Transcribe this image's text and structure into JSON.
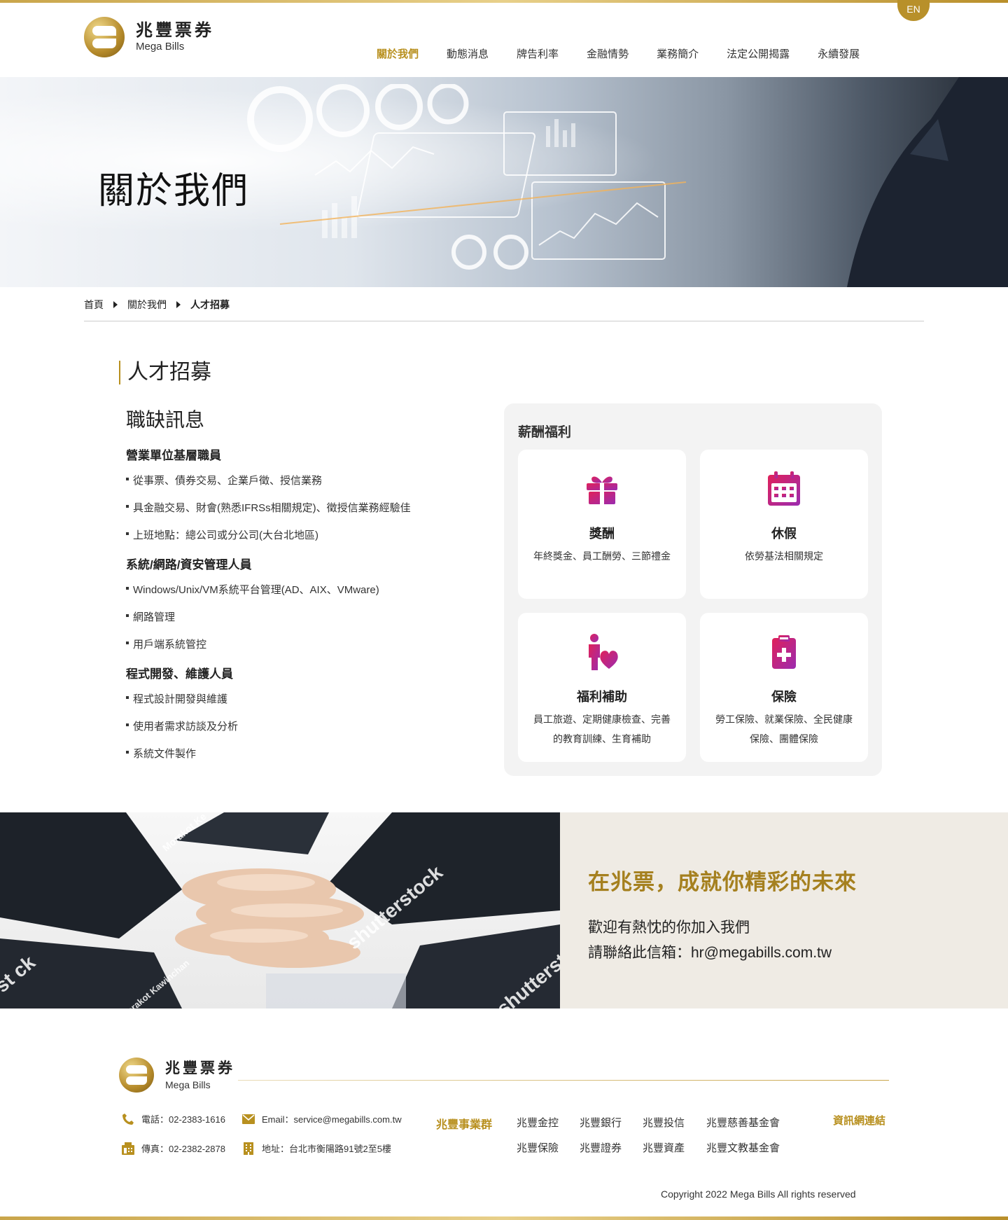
{
  "header": {
    "logo_zh": "兆豐票券",
    "logo_en": "Mega Bills",
    "lang_button": "EN",
    "nav": [
      {
        "label": "關於我們",
        "active": true
      },
      {
        "label": "動態消息",
        "active": false
      },
      {
        "label": "牌告利率",
        "active": false
      },
      {
        "label": "金融情勢",
        "active": false
      },
      {
        "label": "業務簡介",
        "active": false
      },
      {
        "label": "法定公開揭露",
        "active": false
      },
      {
        "label": "永續發展",
        "active": false
      }
    ]
  },
  "hero": {
    "title": "關於我們"
  },
  "breadcrumb": [
    "首頁",
    "關於我們",
    "人才招募"
  ],
  "page": {
    "section_title": "人才招募",
    "subtitle": "職缺訊息"
  },
  "jobs": [
    {
      "title": "營業單位基層職員",
      "items": [
        "從事票、債券交易、企業戶徵、授信業務",
        "具金融交易、財會(熟悉IFRSs相關規定)、徵授信業務經驗佳",
        "上班地點：總公司或分公司(大台北地區)"
      ]
    },
    {
      "title": "系統/網路/資安管理人員",
      "items": [
        "Windows/Unix/VM系統平台管理(AD、AIX、VMware)",
        "網路管理",
        "用戶端系統管控"
      ]
    },
    {
      "title": "程式開發、維護人員",
      "items": [
        "程式設計開發與維護",
        "使用者需求訪談及分析",
        "系統文件製作"
      ]
    }
  ],
  "benefits": {
    "title": "薪酬福利",
    "cards": [
      {
        "icon": "gift-icon",
        "title": "獎酬",
        "desc": "年終獎金、員工酬勞、三節禮金"
      },
      {
        "icon": "calendar-icon",
        "title": "休假",
        "desc": "依勞基法相關規定"
      },
      {
        "icon": "person-heart-icon",
        "title": "福利補助",
        "desc": "員工旅遊、定期健康檢查、完善的教育訓練、生育補助"
      },
      {
        "icon": "medical-clipboard-icon",
        "title": "保險",
        "desc": "勞工保險、就業保險、全民健康保險、團體保險"
      }
    ],
    "icon_colors": [
      "#e0215a",
      "#9b2bb0"
    ]
  },
  "recruit": {
    "title": "在兆票，成就你精彩的未來",
    "line1": "歡迎有熱忱的你加入我們",
    "line2": "請聯絡此信箱：hr@megabills.com.tw",
    "watermarks": [
      "shutterstock",
      "shutterst",
      "st ck",
      "Morakot Ke",
      "Morakot Kawinchan"
    ]
  },
  "footer": {
    "logo_zh": "兆豐票券",
    "logo_en": "Mega Bills",
    "phone": "電話：02-2383-1616",
    "email": "Email：service@megabills.com.tw",
    "fax": "傳真：02-2382-2878",
    "address": "地址：台北市衡陽路91號2至5樓",
    "group_label": "兆豐事業群",
    "group_links": [
      "兆豐金控",
      "兆豐銀行",
      "兆豐投信",
      "兆豐慈善基金會",
      "兆豐保險",
      "兆豐證券",
      "兆豐資產",
      "兆豐文教基金會"
    ],
    "info_link": "資訊網連結",
    "copyright": "Copyright 2022 Mega Bills All rights reserved"
  },
  "colors": {
    "accent_gold": "#b8901f",
    "band_bg": "#efebe4",
    "panel_bg": "#f3f3f3"
  }
}
